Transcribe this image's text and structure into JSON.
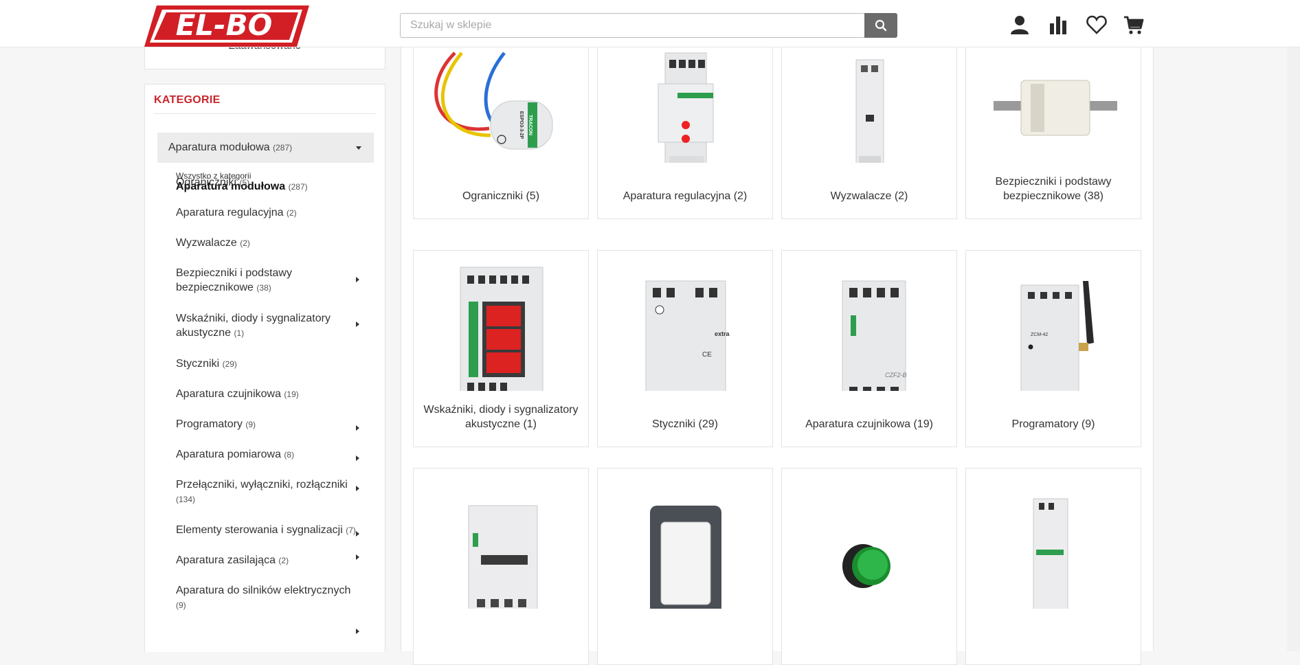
{
  "header": {
    "logo_text": "EL-BO",
    "search_placeholder": "Szukaj w sklepie",
    "icons": [
      "user-icon",
      "compare-icon",
      "heart-icon",
      "cart-icon"
    ]
  },
  "sidebar": {
    "top_partial_text": "Zaawansowane",
    "title": "KATEGORIE",
    "main_category": {
      "label": "Aparatura modułowa",
      "count": "(287)"
    },
    "all_link": {
      "prefix": "Wszystko z kategorii",
      "label": "Aparatura modułowa",
      "count": "(287)"
    },
    "items": [
      {
        "label": "Ograniczniki",
        "count": "(5)"
      },
      {
        "label": "Aparatura regulacyjna",
        "count": "(2)"
      },
      {
        "label": "Wyzwalacze",
        "count": "(2)"
      },
      {
        "label": "Bezpieczniki i podstawy bezpiecznikowe",
        "count": "(38)"
      },
      {
        "label": "Wskaźniki, diody i sygnalizatory akustyczne",
        "count": "(1)"
      },
      {
        "label": "Styczniki",
        "count": "(29)"
      },
      {
        "label": "Aparatura czujnikowa",
        "count": "(19)"
      },
      {
        "label": "Programatory",
        "count": "(9)"
      },
      {
        "label": "Aparatura pomiarowa",
        "count": "(8)"
      },
      {
        "label": "Przełączniki, wyłączniki, rozłączniki",
        "count": "(134)"
      },
      {
        "label": "Elementy sterowania i sygnalizacji",
        "count": "(7)"
      },
      {
        "label": "Aparatura zasilająca",
        "count": "(2)"
      },
      {
        "label": "Aparatura do silników elektrycznych",
        "count": "(9)"
      }
    ]
  },
  "products": [
    {
      "caption": "Ograniczniki  (5)",
      "image_labels": [
        "TRACON",
        "ESPO3-3-2P"
      ]
    },
    {
      "caption": "Aparatura regulacyjna  (2)"
    },
    {
      "caption": "Wyzwalacze  (2)"
    },
    {
      "caption": "Bezpieczniki i podstawy bezpiecznikowe  (38)"
    },
    {
      "caption": "Wskaźniki, diody i sygnalizatory akustyczne  (1)"
    },
    {
      "caption": "Styczniki  (29)",
      "image_labels": [
        "extra"
      ]
    },
    {
      "caption": "Aparatura czujnikowa  (19)",
      "image_labels": [
        "CZF2-B"
      ]
    },
    {
      "caption": "Programatory  (9)",
      "image_labels": [
        "ZCM-42"
      ]
    },
    {
      "caption": ""
    },
    {
      "caption": ""
    },
    {
      "caption": ""
    },
    {
      "caption": ""
    }
  ],
  "colors": {
    "brand_red": "#d21f26",
    "title_red": "#c9252b",
    "search_button": "#6b6b6b"
  }
}
